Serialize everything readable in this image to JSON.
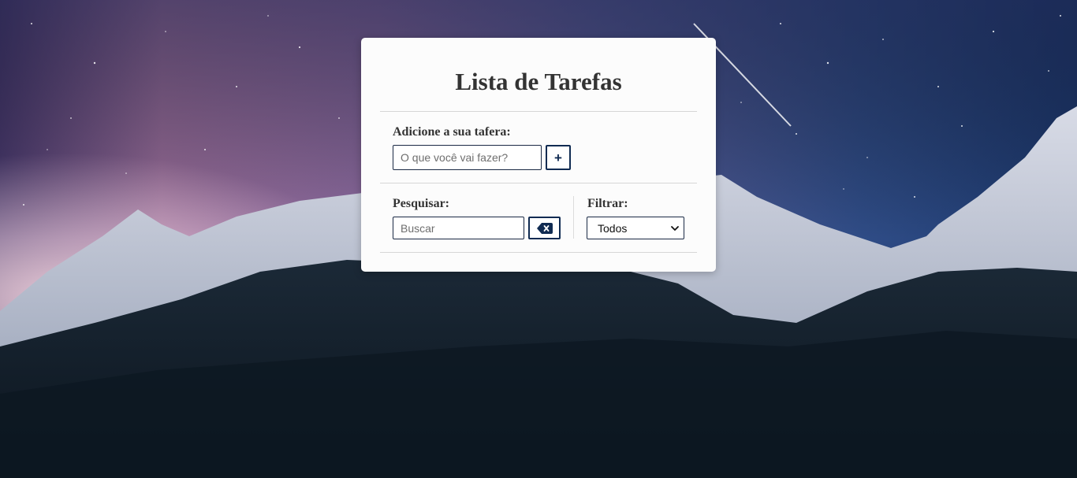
{
  "app": {
    "title": "Lista de Tarefas"
  },
  "add_section": {
    "label": "Adicione a sua tafera:",
    "input_value": "",
    "input_placeholder": "O que você vai fazer?",
    "add_button_label": "+"
  },
  "search_section": {
    "label": "Pesquisar:",
    "input_value": "",
    "input_placeholder": "Buscar",
    "clear_button_icon": "backspace-icon"
  },
  "filter_section": {
    "label": "Filtrar:",
    "selected": "Todos"
  },
  "colors": {
    "card_background": "#fcfcfc",
    "accent": "#102b52",
    "text": "#333333"
  }
}
